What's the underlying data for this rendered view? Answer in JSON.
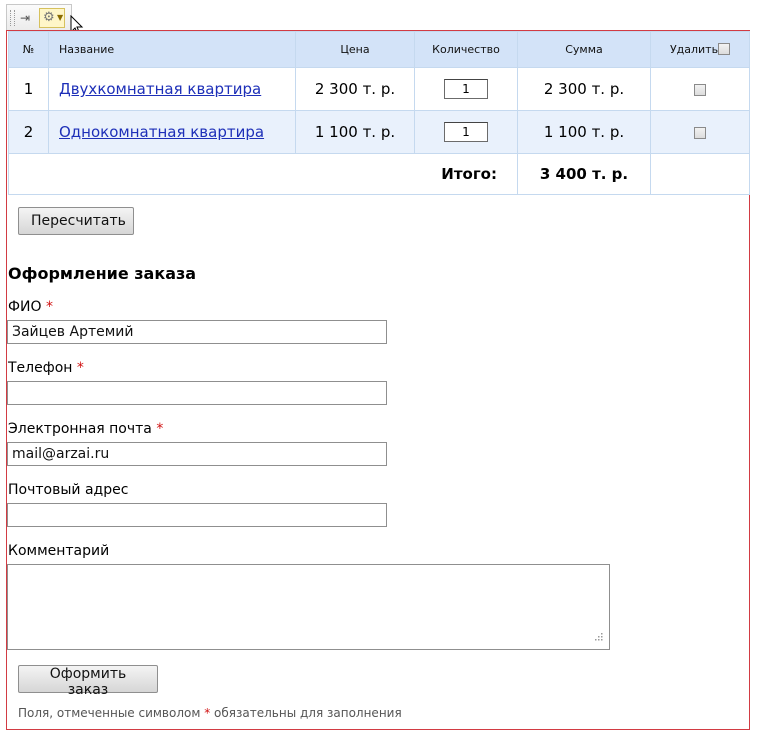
{
  "toolbar": {
    "pin_glyph": "⇥",
    "gear_glyph": "⚙",
    "caret_glyph": "▼",
    "icons": [
      "grip-icon",
      "pin-icon",
      "gear-icon",
      "chevron-down-icon"
    ]
  },
  "table": {
    "headers": {
      "num": "№",
      "name": "Название",
      "price": "Цена",
      "qty": "Количество",
      "sum": "Сумма",
      "delete": "Удалить"
    },
    "rows": [
      {
        "num": "1",
        "name": "Двухкомнатная квартира",
        "price": "2 300 т. р.",
        "qty": "1",
        "sum": "2 300 т. р."
      },
      {
        "num": "2",
        "name": "Однокомнатная квартира",
        "price": "1 100 т. р.",
        "qty": "1",
        "sum": "1 100 т. р."
      }
    ],
    "total_label": "Итого:",
    "total_sum": "3 400 т. р."
  },
  "recalc_label": "Пересчитать",
  "order": {
    "heading": "Оформление заказа",
    "required_mark": "*",
    "fio": {
      "label": "ФИО",
      "value": "Зайцев Артемий"
    },
    "phone": {
      "label": "Телефон",
      "value": ""
    },
    "email": {
      "label": "Электронная почта",
      "value": "mail@arzai.ru"
    },
    "address": {
      "label": "Почтовый адрес",
      "value": ""
    },
    "comment": {
      "label": "Комментарий",
      "value": ""
    },
    "submit_label": "Оформить заказ",
    "note_before": "Поля, отмеченные символом ",
    "note_after": " обязательны для заполнения"
  },
  "colors": {
    "frame_border": "#d23b43",
    "header_bg": "#d3e3f8",
    "row_alt_bg": "#e9f1fc",
    "link": "#1d2fb8",
    "required": "#d01010"
  }
}
